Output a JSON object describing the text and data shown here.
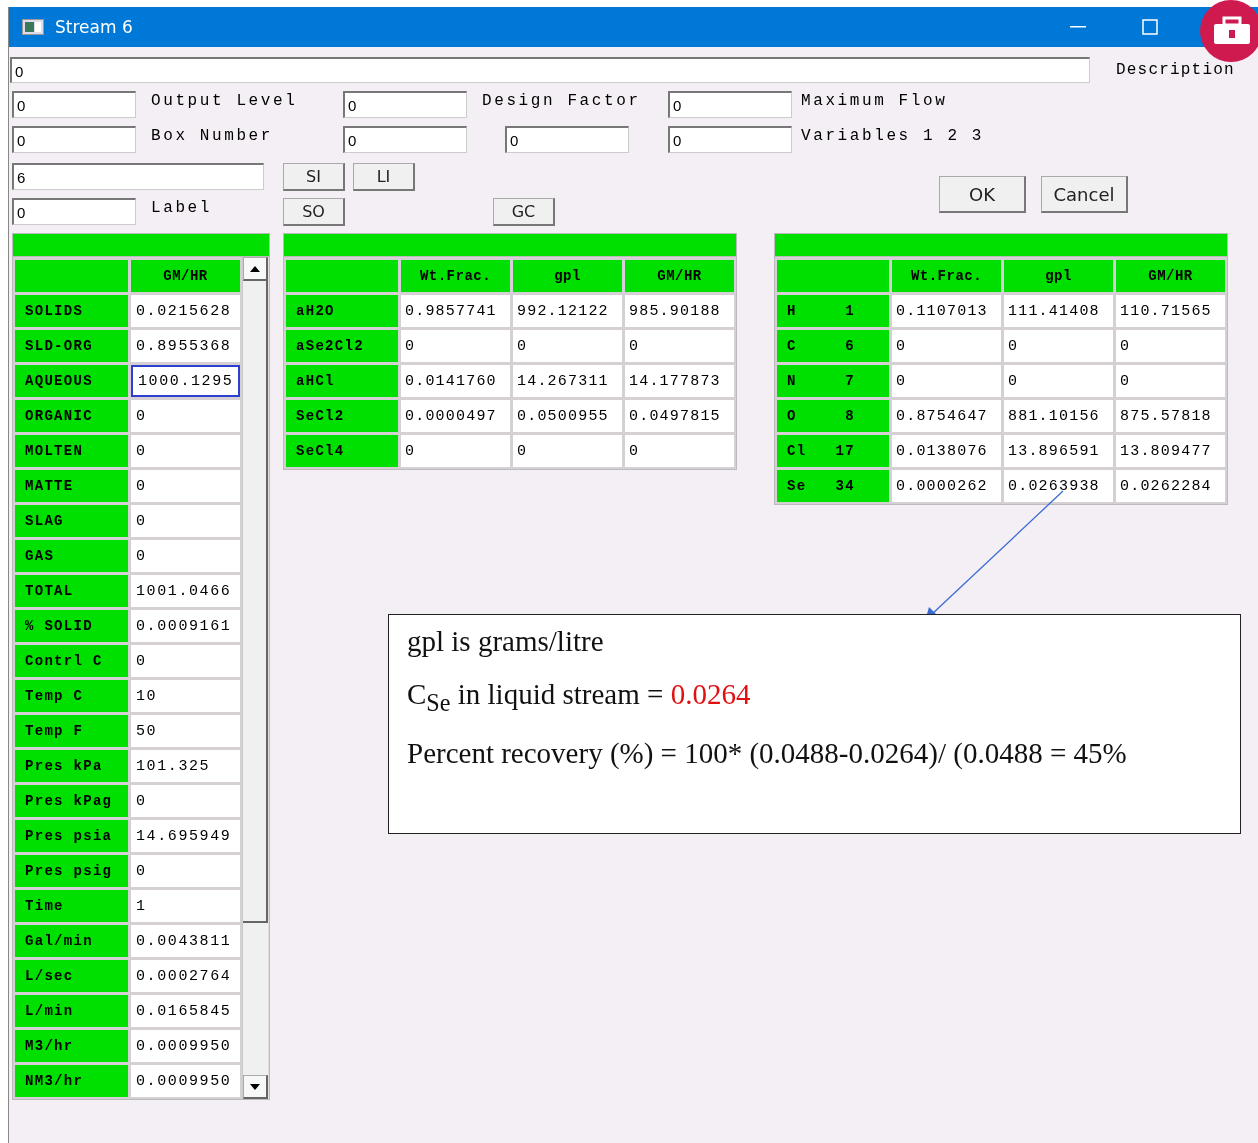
{
  "window": {
    "title": "Stream 6"
  },
  "form": {
    "top_value": "0",
    "description": "Description",
    "grid": [
      [
        {
          "kind": "field",
          "value": "0"
        },
        {
          "kind": "label",
          "text": "Output Level"
        },
        {
          "kind": "field",
          "value": "0"
        },
        {
          "kind": "label",
          "text": "Design Factor"
        },
        {
          "kind": "field",
          "value": "0"
        },
        {
          "kind": "label",
          "text": "Maximum Flow"
        }
      ],
      [
        {
          "kind": "field",
          "value": "0"
        },
        {
          "kind": "label",
          "text": "Box Number"
        },
        {
          "kind": "field",
          "value": "0"
        },
        {
          "kind": "field",
          "value": "0"
        },
        {
          "kind": "field",
          "value": "0"
        },
        {
          "kind": "label",
          "text": "Variables 1 2 3"
        }
      ]
    ],
    "name_value": "6",
    "label_value": "0",
    "label_text": "Label",
    "buttons_top": [
      "SI",
      "LI"
    ],
    "buttons_bottom": [
      "SO",
      "GC"
    ],
    "dialog_buttons": [
      "OK",
      "Cancel"
    ]
  },
  "phases_table": {
    "columns": [
      "GM/HR"
    ],
    "rows": [
      {
        "label": "SOLIDS",
        "value": "0.0215628",
        "selected": false
      },
      {
        "label": "SLD-ORG",
        "value": "0.8955368",
        "selected": false
      },
      {
        "label": "AQUEOUS",
        "value": "1000.1295",
        "selected": true
      },
      {
        "label": "ORGANIC",
        "value": "0",
        "selected": false
      },
      {
        "label": "MOLTEN",
        "value": "0",
        "selected": false
      },
      {
        "label": "MATTE",
        "value": "0",
        "selected": false
      },
      {
        "label": "SLAG",
        "value": "0",
        "selected": false
      },
      {
        "label": "GAS",
        "value": "0",
        "selected": false
      },
      {
        "label": "TOTAL",
        "value": "1001.0466",
        "selected": false
      },
      {
        "label": "% SOLID",
        "value": "0.0009161",
        "selected": false
      },
      {
        "label": "Contrl C",
        "value": "0",
        "selected": false
      },
      {
        "label": "Temp C",
        "value": "10",
        "selected": false
      },
      {
        "label": "Temp F",
        "value": "50",
        "selected": false
      },
      {
        "label": "Pres kPa",
        "value": "101.325",
        "selected": false
      },
      {
        "label": "Pres kPag",
        "value": "0",
        "selected": false
      },
      {
        "label": "Pres psia",
        "value": "14.695949",
        "selected": false
      },
      {
        "label": "Pres psig",
        "value": "0",
        "selected": false
      },
      {
        "label": "Time",
        "value": "1",
        "selected": false
      },
      {
        "label": "Gal/min",
        "value": "0.0043811",
        "selected": false
      },
      {
        "label": "L/sec",
        "value": "0.0002764",
        "selected": false
      },
      {
        "label": "L/min",
        "value": "0.0165845",
        "selected": false
      },
      {
        "label": "M3/hr",
        "value": "0.0009950",
        "selected": false
      },
      {
        "label": "NM3/hr",
        "value": "0.0009950",
        "selected": false
      }
    ]
  },
  "species_table": {
    "columns": [
      "Wt.Frac.",
      "gpl",
      "GM/HR"
    ],
    "rows": [
      {
        "label": "aH2O",
        "values": [
          "0.9857741",
          "992.12122",
          "985.90188"
        ]
      },
      {
        "label": "aSe2Cl2",
        "values": [
          "0",
          "0",
          "0"
        ]
      },
      {
        "label": "aHCl",
        "values": [
          "0.0141760",
          "14.267311",
          "14.177873"
        ]
      },
      {
        "label": "SeCl2",
        "values": [
          "0.0000497",
          "0.0500955",
          "0.0497815"
        ]
      },
      {
        "label": "SeCl4",
        "values": [
          "0",
          "0",
          "0"
        ]
      }
    ]
  },
  "elements_table": {
    "columns": [
      "Wt.Frac.",
      "gpl",
      "GM/HR"
    ],
    "rows": [
      {
        "symbol": "H",
        "number": "1",
        "values": [
          "0.1107013",
          "111.41408",
          "110.71565"
        ]
      },
      {
        "symbol": "C",
        "number": "6",
        "values": [
          "0",
          "0",
          "0"
        ]
      },
      {
        "symbol": "N",
        "number": "7",
        "values": [
          "0",
          "0",
          "0"
        ]
      },
      {
        "symbol": "O",
        "number": "8",
        "values": [
          "0.8754647",
          "881.10156",
          "875.57818"
        ]
      },
      {
        "symbol": "Cl",
        "number": "17",
        "values": [
          "0.0138076",
          "13.896591",
          "13.809477"
        ]
      },
      {
        "symbol": "Se",
        "number": "34",
        "values": [
          "0.0000262",
          "0.0263938",
          "0.0262284"
        ]
      }
    ]
  },
  "annotation": {
    "line_1": "gpl is grams/litre",
    "line_2": "C$_{Se}$ in liquid stream = ",
    "line_2_value": "0.0264",
    "line_3": "Percent recovery (%) = 100* (0.0488-0.0264)/ (0.0488 = 45%"
  }
}
